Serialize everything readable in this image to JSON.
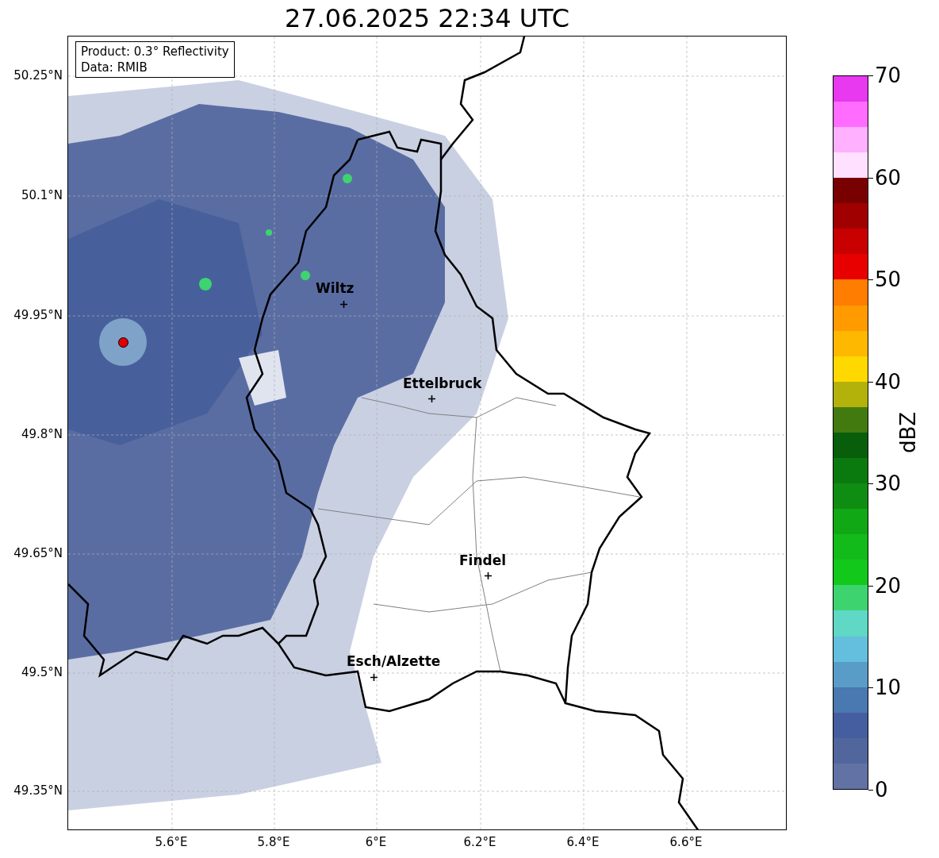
{
  "title": "27.06.2025 22:34 UTC",
  "map": {
    "legend": [
      "Product: 0.3° Reflectivity",
      "Data: RMIB"
    ],
    "cities": [
      {
        "name": "Wiltz"
      },
      {
        "name": "Ettelbruck"
      },
      {
        "name": "Findel"
      },
      {
        "name": "Esch/Alzette"
      }
    ],
    "lat_ticks": [
      "50.25°N",
      "50.1°N",
      "49.95°N",
      "49.8°N",
      "49.65°N",
      "49.5°N",
      "49.35°N"
    ],
    "lon_ticks": [
      "5.6°E",
      "5.8°E",
      "6°E",
      "6.2°E",
      "6.4°E",
      "6.6°E"
    ]
  },
  "colorbar": {
    "label": "dBZ",
    "ticks": [
      "70",
      "60",
      "50",
      "40",
      "30",
      "20",
      "10",
      "0"
    ],
    "bins": [
      {
        "color": "#6272a4"
      },
      {
        "color": "#52669e"
      },
      {
        "color": "#455e9f"
      },
      {
        "color": "#4a78b0"
      },
      {
        "color": "#5a9cc8"
      },
      {
        "color": "#64bedd"
      },
      {
        "color": "#5fd8c5"
      },
      {
        "color": "#3dd470"
      },
      {
        "color": "#12c81a"
      },
      {
        "color": "#12bb1a"
      },
      {
        "color": "#10a814"
      },
      {
        "color": "#0e8d12"
      },
      {
        "color": "#0b7a0e"
      },
      {
        "color": "#085e0a"
      },
      {
        "color": "#437a10"
      },
      {
        "color": "#b2b20a"
      },
      {
        "color": "#ffd800"
      },
      {
        "color": "#ffb800"
      },
      {
        "color": "#ff9a00"
      },
      {
        "color": "#ff7d00"
      },
      {
        "color": "#e80000"
      },
      {
        "color": "#c80000"
      },
      {
        "color": "#a00000"
      },
      {
        "color": "#780000"
      },
      {
        "color": "#ffe0ff"
      },
      {
        "color": "#ffb0ff"
      },
      {
        "color": "#ff6cff"
      },
      {
        "color": "#e838f0"
      }
    ]
  }
}
